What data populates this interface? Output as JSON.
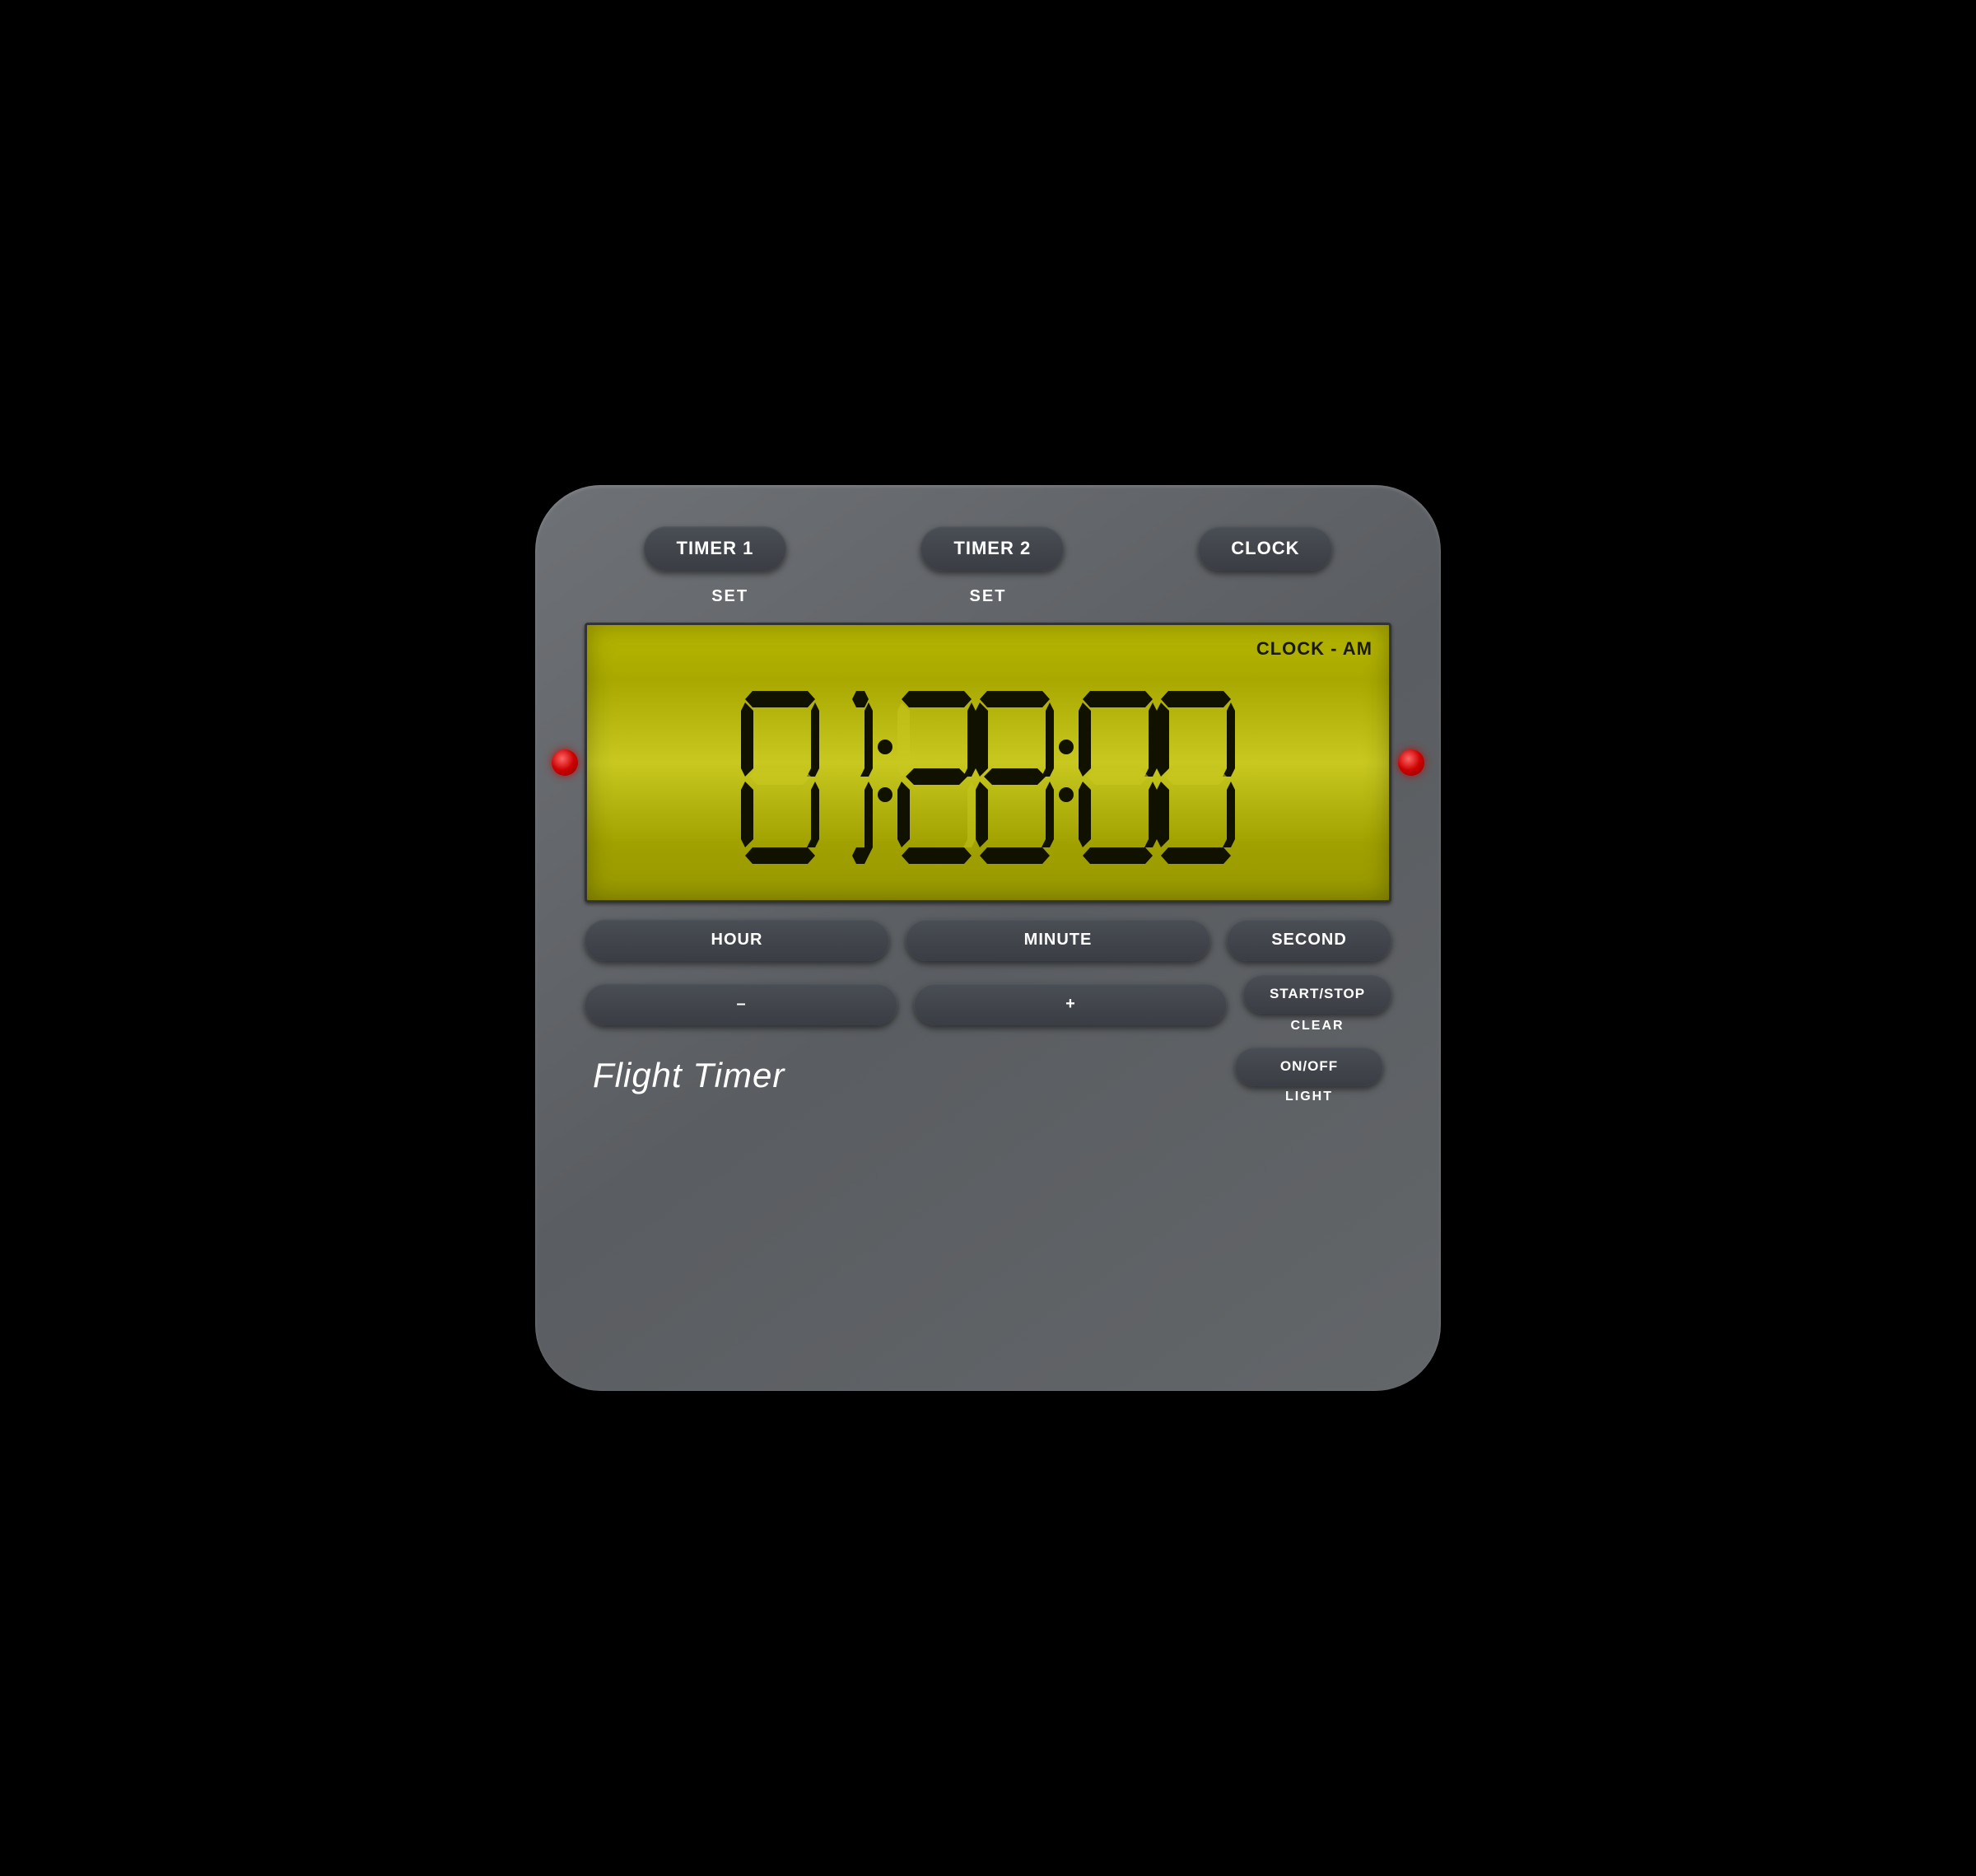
{
  "device": {
    "title": "Flight Timer",
    "display": {
      "mode": "CLOCK - AM",
      "time": "01:28:00"
    },
    "top_buttons": [
      {
        "id": "timer1",
        "label": "TIMER 1"
      },
      {
        "id": "timer2",
        "label": "TIMER 2"
      },
      {
        "id": "clock",
        "label": "CLOCK"
      }
    ],
    "set_labels": [
      {
        "id": "set1",
        "label": "SET"
      },
      {
        "id": "set2",
        "label": "SET"
      }
    ],
    "adjust_buttons": [
      {
        "id": "hour",
        "label": "HOUR"
      },
      {
        "id": "minute",
        "label": "MINUTE"
      },
      {
        "id": "second",
        "label": "SECOND"
      }
    ],
    "control_buttons": [
      {
        "id": "minus",
        "label": "–"
      },
      {
        "id": "plus",
        "label": "+"
      },
      {
        "id": "startstop",
        "label": "START/STOP"
      }
    ],
    "sub_labels": {
      "clear": "CLEAR",
      "light": "LIGHT"
    },
    "extra_buttons": [
      {
        "id": "onoff",
        "label": "ON/OFF"
      }
    ]
  }
}
